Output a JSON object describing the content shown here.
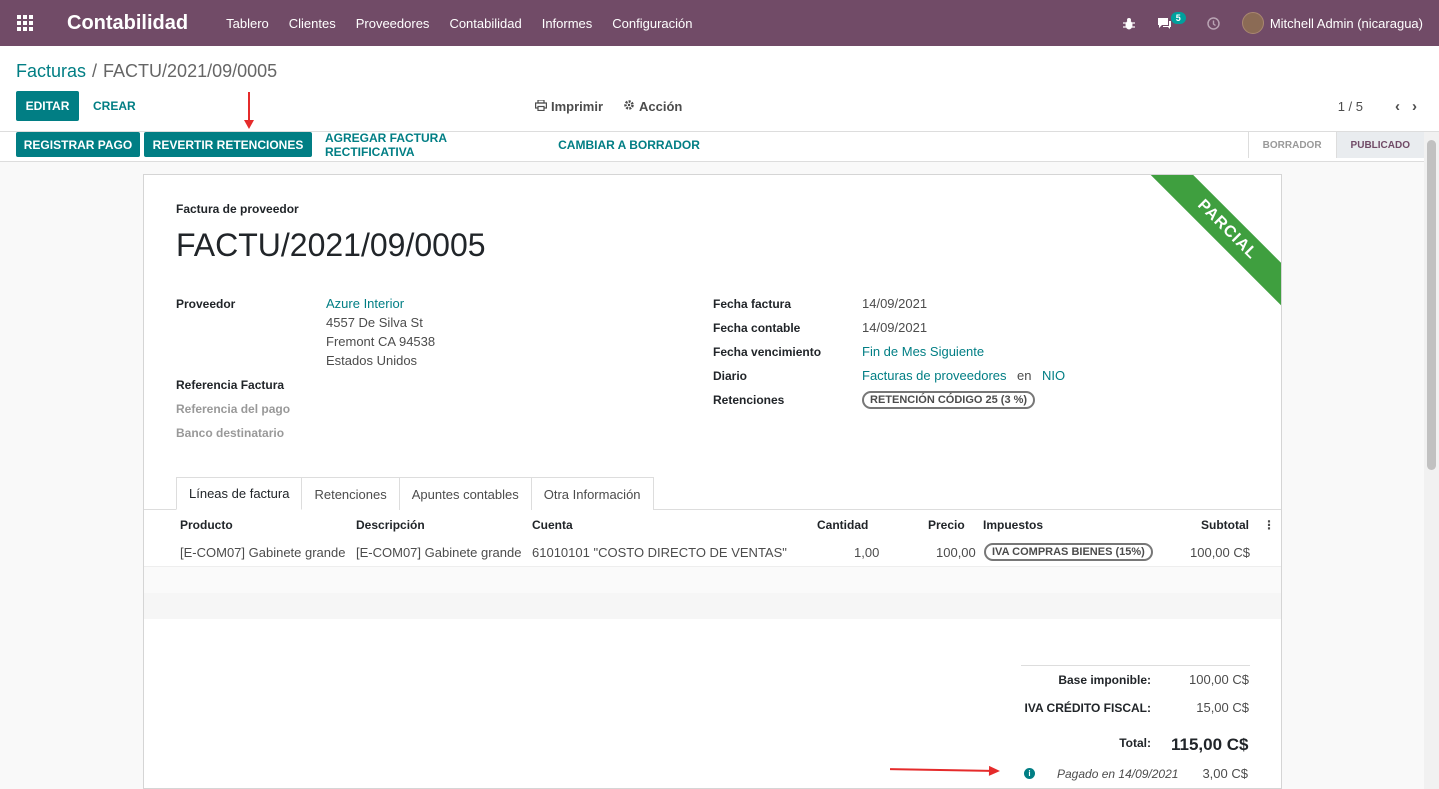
{
  "navbar": {
    "brand": "Contabilidad",
    "menu": [
      "Tablero",
      "Clientes",
      "Proveedores",
      "Contabilidad",
      "Informes",
      "Configuración"
    ],
    "messages_count": "5",
    "user": "Mitchell Admin (nicaragua)"
  },
  "breadcrumb": {
    "parent": "Facturas",
    "separator": "/",
    "current": "FACTU/2021/09/0005"
  },
  "toolbar": {
    "edit": "EDITAR",
    "create": "CREAR",
    "print": "Imprimir",
    "action": "Acción",
    "pager": "1 / 5"
  },
  "statusbar": {
    "buttons": [
      "REGISTRAR PAGO",
      "REVERTIR RETENCIONES",
      "AGREGAR FACTURA RECTIFICATIVA",
      "CAMBIAR A BORRADOR"
    ],
    "stages": [
      "BORRADOR",
      "PUBLICADO"
    ],
    "active_stage": "PUBLICADO"
  },
  "sheet": {
    "ribbon": "PARCIAL",
    "doc_type": "Factura de proveedor",
    "doc_name": "FACTU/2021/09/0005",
    "left_fields": {
      "proveedor_label": "Proveedor",
      "proveedor_name": "Azure Interior",
      "address_line1": "4557 De Silva St",
      "address_line2": "Fremont CA 94538",
      "address_line3": "Estados Unidos",
      "ref_factura_label": "Referencia Factura",
      "ref_pago_label": "Referencia del pago",
      "banco_label": "Banco destinatario"
    },
    "right_fields": {
      "fecha_factura_label": "Fecha factura",
      "fecha_factura": "14/09/2021",
      "fecha_contable_label": "Fecha contable",
      "fecha_contable": "14/09/2021",
      "fecha_venc_label": "Fecha vencimiento",
      "fecha_venc": "Fin de Mes Siguiente",
      "diario_label": "Diario",
      "diario": "Facturas de proveedores",
      "diario_en": "en",
      "currency": "NIO",
      "retenciones_label": "Retenciones",
      "retencion_tag": "RETENCIÓN CÓDIGO 25 (3 %)"
    },
    "tabs": [
      "Líneas de factura",
      "Retenciones",
      "Apuntes contables",
      "Otra Información"
    ],
    "table": {
      "headers": [
        "Producto",
        "Descripción",
        "Cuenta",
        "Cantidad",
        "Precio",
        "Impuestos",
        "Subtotal"
      ],
      "rows": [
        {
          "producto": "[E-COM07] Gabinete grande",
          "descripcion": "[E-COM07] Gabinete grande",
          "cuenta": "61010101 \"COSTO DIRECTO DE VENTAS\"",
          "cantidad": "1,00",
          "precio": "100,00",
          "impuesto": "IVA COMPRAS BIENES (15%)",
          "subtotal": "100,00 C$"
        }
      ]
    },
    "totals": {
      "base_label": "Base imponible:",
      "base_value": "100,00 C$",
      "iva_label": "IVA CRÉDITO FISCAL:",
      "iva_value": "15,00 C$",
      "total_label": "Total:",
      "total_value": "115,00 C$",
      "paid_label": "Pagado en 14/09/2021",
      "paid_value": "3,00 C$"
    }
  },
  "colors": {
    "navbar": "#714b67",
    "primary": "#017e84",
    "ribbon": "#3f9f3f",
    "annotation": "#e52b2b"
  }
}
